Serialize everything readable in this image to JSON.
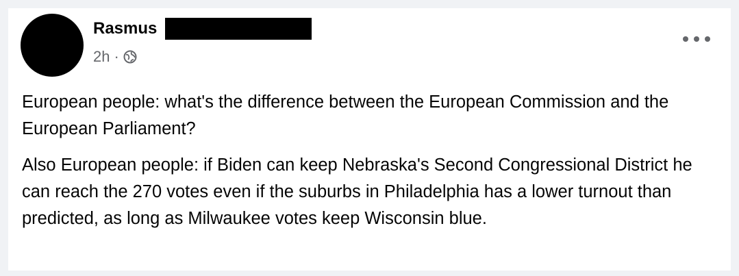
{
  "post": {
    "author": {
      "name": "Rasmus"
    },
    "meta": {
      "time": "2h",
      "separator": "·",
      "privacy_icon": "globe-icon"
    },
    "menu_icon": "more-options-icon",
    "paragraphs": [
      "European people: what's the difference between the European Commission and the European Parliament?",
      "Also European people: if Biden can keep Nebraska's Second Congressional District he can reach the 270 votes even if the suburbs in Philadelphia has a lower turnout than predicted, as long as Milwaukee votes keep Wisconsin blue."
    ]
  },
  "colors": {
    "text": "#050505",
    "secondary": "#65676b",
    "background": "#ffffff",
    "redaction": "#000000"
  }
}
